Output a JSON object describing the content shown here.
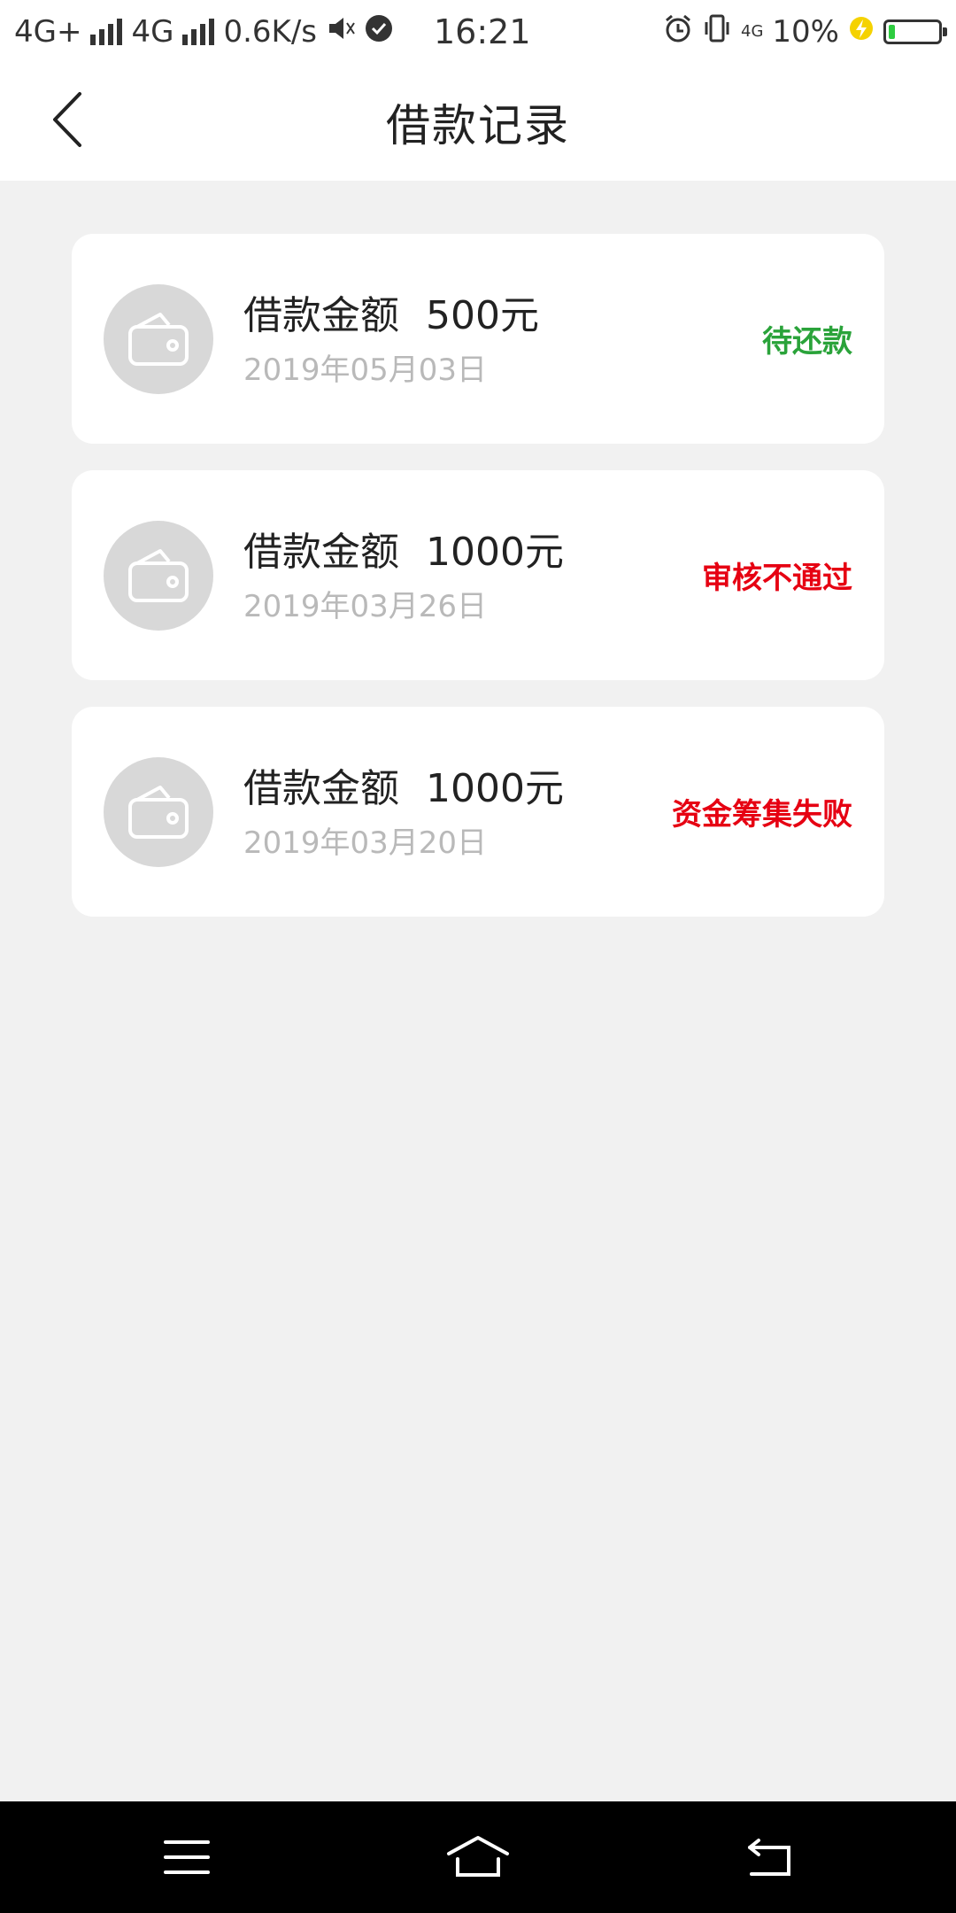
{
  "status_bar": {
    "network1": "4G+",
    "network2": "4G",
    "speed": "0.6K/s",
    "time": "16:21",
    "network3": "4G",
    "battery": "10%"
  },
  "header": {
    "title": "借款记录"
  },
  "records": [
    {
      "label": "借款金额",
      "amount": "500元",
      "date": "2019年05月03日",
      "status": "待还款",
      "status_color": "#2aa33a"
    },
    {
      "label": "借款金额",
      "amount": "1000元",
      "date": "2019年03月26日",
      "status": "审核不通过",
      "status_color": "#e60012"
    },
    {
      "label": "借款金额",
      "amount": "1000元",
      "date": "2019年03月20日",
      "status": "资金筹集失败",
      "status_color": "#e60012"
    }
  ],
  "icons": {
    "back": "chevron-left-icon",
    "wallet": "wallet-icon",
    "menu": "menu-icon",
    "home": "home-icon",
    "return": "return-icon"
  }
}
